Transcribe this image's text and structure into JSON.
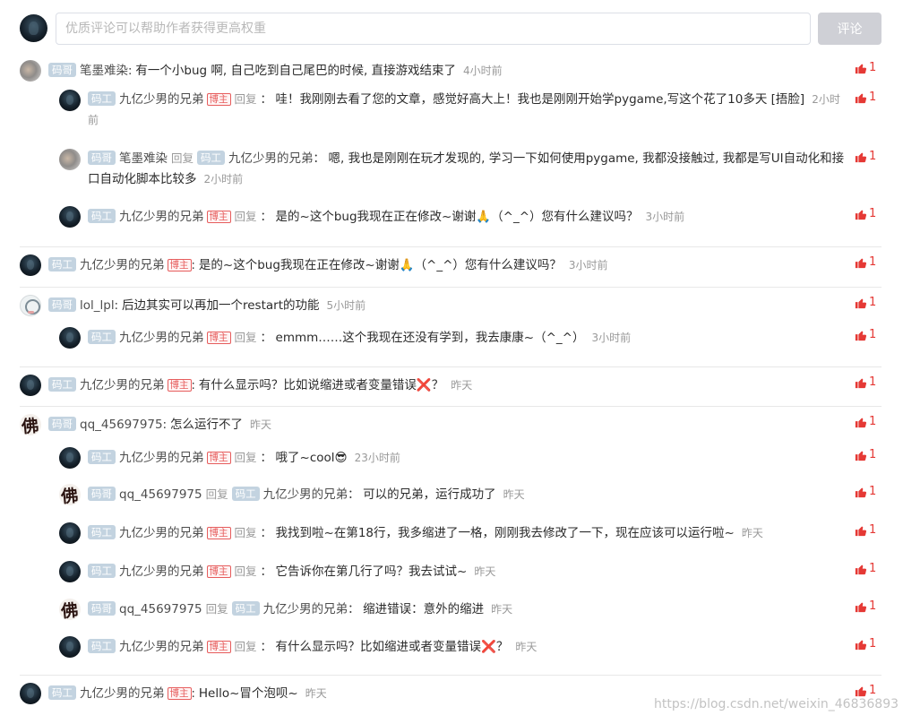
{
  "editor": {
    "placeholder": "优质评论可以帮助作者获得更高权重",
    "submit_label": "评论"
  },
  "ui": {
    "reply_word": "回复",
    "host_badge": "博主",
    "like_icon": "thumb-up-icon",
    "like_color": "#e53935",
    "badge_color": "#c3d3e0",
    "submit_color": "#cfd0d6"
  },
  "comments": [
    {
      "user": "笔墨难染",
      "level": "码哥",
      "avatar": "gray",
      "text": "有一个小bug 啊, 自己吃到自己尾巴的时候, 直接游戏结束了",
      "time": "4小时前",
      "likes": "1",
      "replies": [
        {
          "user": "九亿少男的兄弟",
          "level": "码工",
          "host": true,
          "avatar": "dark",
          "text": "哇！我刚刚去看了您的文章，感觉好高大上！我也是刚刚开始学pygame,写这个花了10多天 [捂脸]",
          "time": "2小时前",
          "likes": "1"
        },
        {
          "user": "笔墨难染",
          "level": "码哥",
          "avatar": "gray",
          "target": "九亿少男的兄弟",
          "target_level": "码工",
          "text": "嗯, 我也是刚刚在玩才发现的, 学习一下如何使用pygame, 我都没接触过, 我都是写UI自动化和接口自动化脚本比较多",
          "time": "2小时前",
          "likes": "1"
        },
        {
          "user": "九亿少男的兄弟",
          "level": "码工",
          "host": true,
          "avatar": "dark",
          "text": "是的~这个bug我现在正在修改~谢谢🙏（^_^）您有什么建议吗？",
          "time": "3小时前",
          "likes": "1"
        }
      ]
    },
    {
      "user": "九亿少男的兄弟",
      "level": "码工",
      "host": true,
      "avatar": "dark",
      "text": "是的~这个bug我现在正在修改~谢谢🙏（^_^）您有什么建议吗？",
      "time": "3小时前",
      "likes": "1",
      "replies": []
    },
    {
      "user": "lol_lpl",
      "level": "码哥",
      "avatar": "cartoon",
      "text": "后边其实可以再加一个restart的功能",
      "time": "5小时前",
      "likes": "1",
      "replies": [
        {
          "user": "九亿少男的兄弟",
          "level": "码工",
          "host": true,
          "avatar": "dark",
          "text": "emmm……这个我现在还没有学到，我去康康~（^_^）",
          "time": "3小时前",
          "likes": "1"
        }
      ]
    },
    {
      "user": "九亿少男的兄弟",
      "level": "码工",
      "host": true,
      "avatar": "dark",
      "text": "有什么显示吗？比如说缩进或者变量错误❌？",
      "time": "昨天",
      "likes": "1",
      "replies": []
    },
    {
      "user": "qq_45697975",
      "level": "码哥",
      "avatar": "calli",
      "text": "怎么运行不了",
      "time": "昨天",
      "likes": "1",
      "replies": [
        {
          "user": "九亿少男的兄弟",
          "level": "码工",
          "host": true,
          "avatar": "dark",
          "text": "哦了~cool😎",
          "time": "23小时前",
          "likes": "1"
        },
        {
          "user": "qq_45697975",
          "level": "码哥",
          "avatar": "calli",
          "target": "九亿少男的兄弟",
          "target_level": "码工",
          "text": "可以的兄弟，运行成功了",
          "time": "昨天",
          "likes": "1"
        },
        {
          "user": "九亿少男的兄弟",
          "level": "码工",
          "host": true,
          "avatar": "dark",
          "text": "我找到啦~在第18行，我多缩进了一格，刚刚我去修改了一下，现在应该可以运行啦~",
          "time": "昨天",
          "likes": "1"
        },
        {
          "user": "九亿少男的兄弟",
          "level": "码工",
          "host": true,
          "avatar": "dark",
          "text": "它告诉你在第几行了吗？我去试试~",
          "time": "昨天",
          "likes": "1"
        },
        {
          "user": "qq_45697975",
          "level": "码哥",
          "avatar": "calli",
          "target": "九亿少男的兄弟",
          "target_level": "码工",
          "text": "缩进错误：意外的缩进",
          "time": "昨天",
          "likes": "1"
        },
        {
          "user": "九亿少男的兄弟",
          "level": "码工",
          "host": true,
          "avatar": "dark",
          "text": "有什么显示吗？比如缩进或者变量错误❌？",
          "time": "昨天",
          "likes": "1"
        }
      ]
    },
    {
      "user": "九亿少男的兄弟",
      "level": "码工",
      "host": true,
      "avatar": "dark",
      "text": "Hello~冒个泡呗~",
      "time": "昨天",
      "likes": "1",
      "replies": []
    }
  ],
  "watermark": "https://blog.csdn.net/weixin_46836893"
}
